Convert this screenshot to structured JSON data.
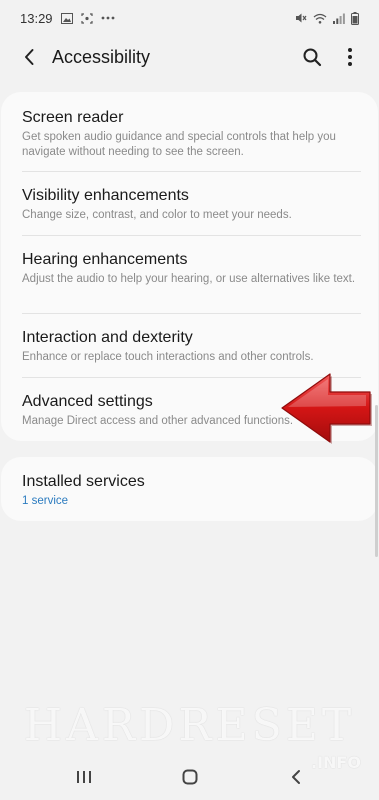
{
  "status_bar": {
    "time": "13:29",
    "left_icons": [
      "image-icon",
      "screenshot-icon",
      "more-dots-icon"
    ],
    "right_icons": [
      "mute-icon",
      "wifi-icon",
      "signal-icon",
      "battery-icon"
    ]
  },
  "header": {
    "title": "Accessibility"
  },
  "sections": {
    "main": [
      {
        "title": "Screen reader",
        "subtitle": "Get spoken audio guidance and special controls that help you navigate without needing to see the screen."
      },
      {
        "title": "Visibility enhancements",
        "subtitle": "Change size, contrast, and color to meet your needs."
      },
      {
        "title": "Hearing enhancements",
        "subtitle": "Adjust the audio to help your hearing, or use alternatives like text."
      },
      {
        "title": "Interaction and dexterity",
        "subtitle": "Enhance or replace touch interactions and other controls."
      },
      {
        "title": "Advanced settings",
        "subtitle": "Manage Direct access and other advanced functions."
      }
    ],
    "services": {
      "title": "Installed services",
      "subtitle": "1 service"
    }
  },
  "watermark": {
    "text": "HARDRESET",
    "suffix": ".INFO"
  },
  "colors": {
    "background": "#f2f2f2",
    "card": "#fafafa",
    "accent_link": "#2b7bbf",
    "arrow": "#d41515"
  },
  "nav_bar": {
    "icons": [
      "recent-apps-icon",
      "home-icon",
      "back-icon"
    ]
  }
}
